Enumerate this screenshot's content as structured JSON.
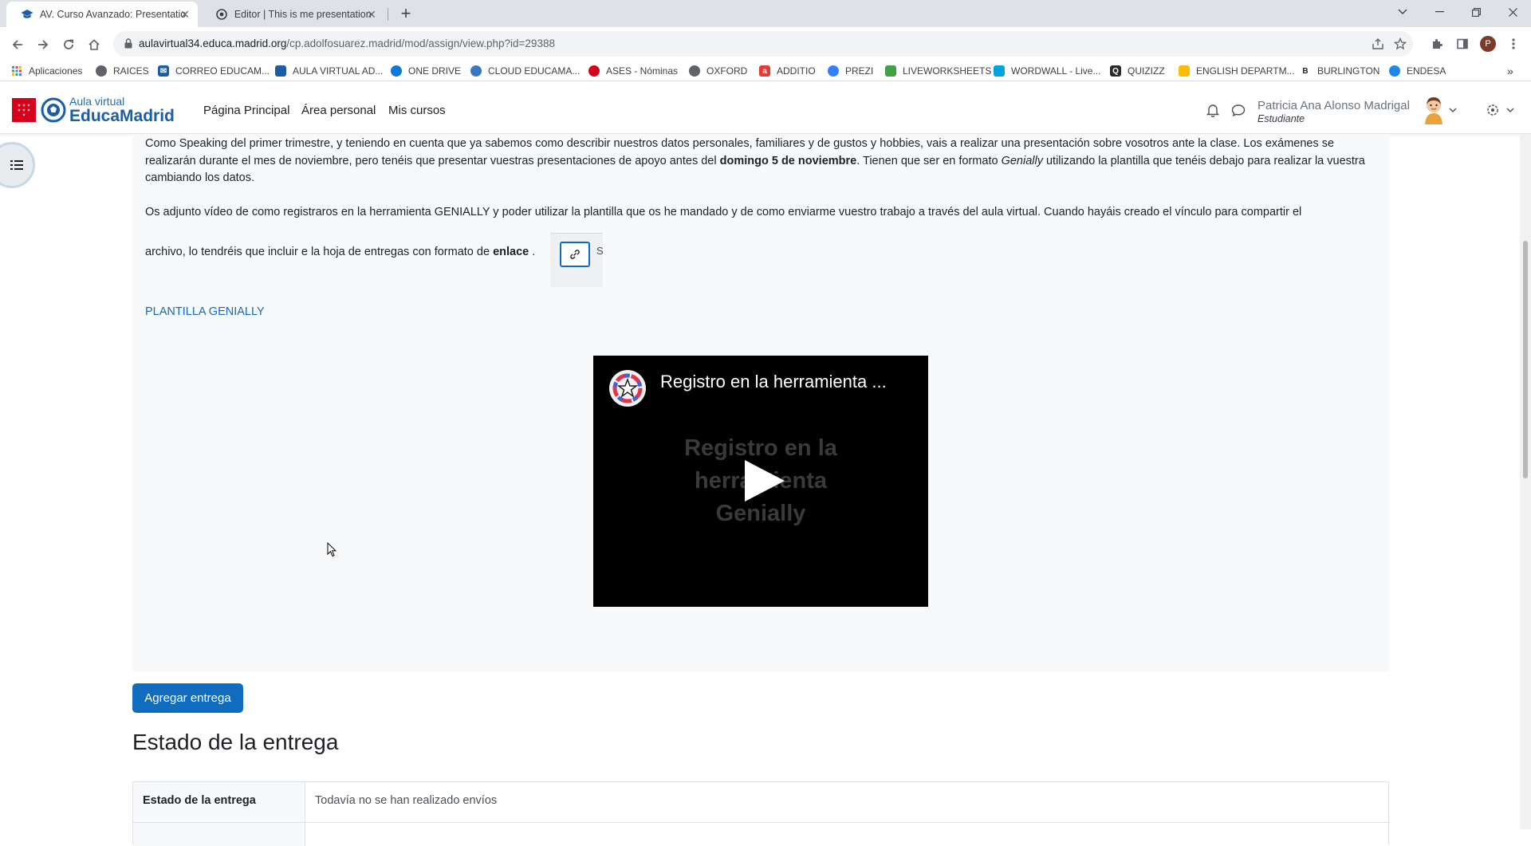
{
  "browser": {
    "tabs": [
      {
        "title": "AV. Curso Avanzado: Presentatio",
        "active": true
      },
      {
        "title": "Editor | This is me presentation",
        "active": false
      }
    ],
    "url_host": "aulavirtual34.educa.madrid.org",
    "url_path": "/cp.adolfosuarez.madrid/mod/assign/view.php?id=29388",
    "profile_initial": "P",
    "bookmarks": [
      {
        "label": "Aplicaciones",
        "icon": "apps-grid-icon"
      },
      {
        "label": "RAICES",
        "icon": "globe-icon"
      },
      {
        "label": "CORREO EDUCAM...",
        "icon": "mail-icon"
      },
      {
        "label": "AULA VIRTUAL AD...",
        "icon": "graduation-cap-icon"
      },
      {
        "label": "ONE DRIVE",
        "icon": "cloud-icon"
      },
      {
        "label": "CLOUD EDUCAMA...",
        "icon": "cloud-circle-icon"
      },
      {
        "label": "ASES - Nóminas",
        "icon": "red-circle-icon"
      },
      {
        "label": "OXFORD",
        "icon": "globe-icon"
      },
      {
        "label": "ADDITIO",
        "icon": "additio-icon"
      },
      {
        "label": "PREZI",
        "icon": "prezi-icon"
      },
      {
        "label": "LIVEWORKSHEETS",
        "icon": "liveworksheets-icon"
      },
      {
        "label": "WORDWALL - Live...",
        "icon": "wordwall-icon"
      },
      {
        "label": "QUIZIZZ",
        "icon": "quizizz-icon"
      },
      {
        "label": "ENGLISH DEPARTM...",
        "icon": "drive-icon"
      },
      {
        "label": "BURLINGTON",
        "icon": "burlington-icon"
      },
      {
        "label": "ENDESA",
        "icon": "endesa-icon"
      }
    ]
  },
  "moodle": {
    "logo_small": "Aula virtual",
    "logo_big": "EducaMadrid",
    "nav": [
      "Página Principal",
      "Área personal",
      "Mis cursos"
    ],
    "user_name": "Patricia Ana Alonso Madrigal",
    "user_role": "Estudiante"
  },
  "content": {
    "para1_a": "Como Speaking del primer trimestre, y teniendo en cuenta que ya sabemos como describir nuestros datos personales, familiares y de gustos y hobbies, vais a realizar una presentación sobre vosotros ante la clase. Los exámenes se realizarán durante el mes de noviembre, pero tenéis que presentar vuestras presentaciones de apoyo antes del ",
    "para1_b": "domingo 5 de noviembre",
    "para1_c": ". Tienen que ser en formato ",
    "para1_d": "Genially",
    "para1_e": "  utilizando la plantilla que tenéis debajo para realizar la vuestra cambiando los datos.",
    "para2_line1": "Os adjunto vídeo de como registraros en la herramienta GENIALLY y poder utilizar la plantilla que os he mandado y de como enviarme vuestro trabajo a través del aula virtual. Cuando hayáis creado el vínculo para compartir el",
    "para2_line2_a": "archivo, lo tendréis que incluir e la hoja de entregas con formato de ",
    "para2_line2_b": "enlace",
    "para2_line2_c": " .",
    "link_tool_next": "S",
    "plantilla_link": "PLANTILLA GENIALLY",
    "video_title": "Registro en la herramienta ...",
    "video_thumb_lines": [
      "Registro en la",
      "herramienta",
      "Genially"
    ],
    "add_button": "Agregar entrega",
    "section_heading": "Estado de la entrega",
    "table": {
      "label": "Estado de la entrega",
      "value": "Todavía no se han realizado envíos"
    }
  },
  "colors": {
    "brand_blue": "#0f6cbf",
    "madrid_red": "#d6001c"
  }
}
